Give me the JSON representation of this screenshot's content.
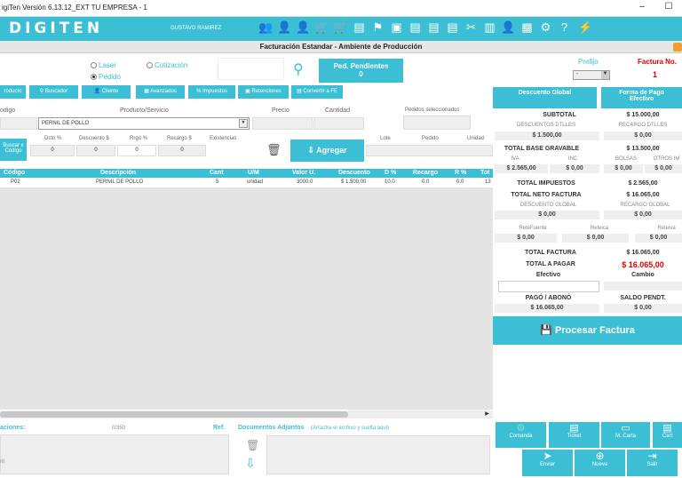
{
  "window": {
    "title": "igiTen Versión 6.13.12_EXT TU EMPRESA - 1",
    "minimize": "–",
    "maximize": "☐"
  },
  "header": {
    "logo": "DIGITEN",
    "user": "GUSTAVO RAMIREZ",
    "subtitle": "Facturación Estandar  -  Ambiente de Producción"
  },
  "print": {
    "laser": "Laser",
    "pedido": "Pedido",
    "cotizacion": "Cotización"
  },
  "pendientes": {
    "label": "Ped. Pendientes",
    "count": "0"
  },
  "prefijo": {
    "label": "Prefijo",
    "value": "-"
  },
  "factura": {
    "label": "Factura No.",
    "value": "1"
  },
  "toolbar": {
    "producto": "roducto",
    "buscador": "Buscador",
    "cliente": "Cliente",
    "avanzados": "Avanzados",
    "impuestos": "Impuestos",
    "retenciones": "Retenciones",
    "convertir": "Convertir a FE"
  },
  "form": {
    "codigo": "odigo",
    "producto": "Producto/Servicio",
    "producto_value": "PERNIL DE POLLO",
    "precio": "Precio",
    "cantidad": "Cantidad",
    "pedidos_sel": "Pedidos seleccionados",
    "buscar": "Buscar x Codigo",
    "dcto": "Dcto %",
    "descuento": "Descuento $",
    "rrgo": "Rrgo %",
    "recargo": "Recargo $",
    "existencias": "Existencias",
    "dcto_v": "0",
    "descuento_v": "0",
    "rrgo_v": "0",
    "recargo_v": "0",
    "agregar": "Agregar",
    "lote": "Lote",
    "pedido": "Pedido",
    "unidad": "Unidad"
  },
  "grid": {
    "headers": [
      "Código",
      "Descripción",
      "Cant",
      "U/M",
      "Valor U.",
      "Descuento",
      "D %",
      "Recargo",
      "R %",
      "Tot"
    ],
    "row": [
      "P02",
      "PERNIL DE POLLO",
      "5",
      "unidad",
      "3000.0",
      "$ 1.500,00",
      "10.0",
      "0.0",
      "0.0",
      "13"
    ]
  },
  "footer": {
    "observaciones": "aciones:",
    "count": "0/350",
    "ref": "Ref.",
    "documentos": "Documentos Adjuntos",
    "hint": "(Arrastra el archivo y suelta aqui)",
    "ent": "nt"
  },
  "right": {
    "descuento_global": "Descuento Global",
    "forma_pago": "Forma de Pago Efectivo",
    "subtotal_l": "SUBTOTAL",
    "subtotal_v": "$ 15.000,00",
    "desc_dtlles": "DESCUENTOS DTLLES",
    "desc_dtlles_v": "$ 1.500,00",
    "rec_dtlles": "RECARGO DTLLES",
    "rec_dtlles_v": "$ 0,00",
    "base_l": "TOTAL BASE GRAVABLE",
    "base_v": "$ 13.500,00",
    "iva": "IVA",
    "inc": "INC",
    "bolsas": "BOLSAS",
    "otros": "OTROS IM",
    "iva_v": "$ 2.565,00",
    "inc_v": "$ 0,00",
    "bolsas_v": "$ 0,00",
    "otros_v": "$ 0,00",
    "imp_l": "TOTAL IMPUESTOS",
    "imp_v": "$ 2.565,00",
    "neto_l": "TOTAL NETO FACTURA",
    "neto_v": "$ 16.065,00",
    "dg_l": "DESCUENTO GLOBAL",
    "dg_v": "$ 0,00",
    "rg_l": "RECARGO GLOBAL",
    "rg_v": "$ 0,00",
    "rf": "ReteFuente",
    "rica": "Reteica",
    "riva": "Reteiva",
    "rf_v": "$ 0,00",
    "rica_v": "$ 0,00",
    "riva_v": "$ 0,00",
    "tf_l": "TOTAL FACTURA",
    "tf_v": "$ 16.065,00",
    "tp_l": "TOTAL A PAGAR",
    "tp_v": "$ 16.065,00",
    "efectivo": "Efectivo",
    "cambio": "Cambio",
    "pago_l": "PAGÓ / ABONÓ",
    "pago_v": "$ 16.065,00",
    "saldo_l": "SALDO PENDT.",
    "saldo_v": "$ 0,00",
    "procesar": "Procesar Factura"
  },
  "actions": {
    "comanda": "Comanda",
    "ticket": "Ticket",
    "mcarta": "M. Carta",
    "carta": "Cart",
    "enviar": "Enviar",
    "nueva": "Nueva",
    "salir": "Salir"
  },
  "colors": {
    "accent": "#3cbfd4",
    "red": "#e00000"
  }
}
